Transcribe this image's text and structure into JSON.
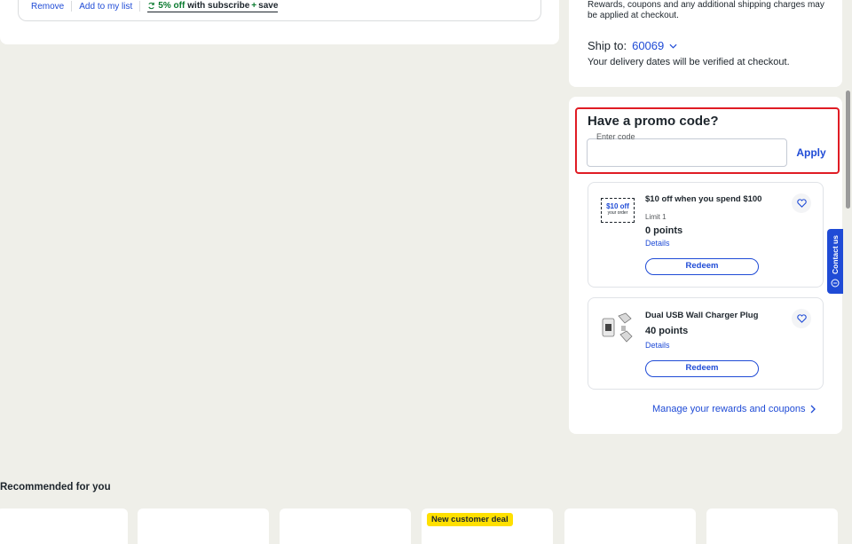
{
  "cart": {
    "remove_label": "Remove",
    "add_list_label": "Add to my list",
    "subscribe_pct": "5% off",
    "subscribe_with": "with subscribe",
    "subscribe_plus": "+",
    "subscribe_save": "save"
  },
  "summary": {
    "note": "Rewards, coupons and any additional shipping charges may be applied at checkout.",
    "ship_label": "Ship to:",
    "zip": "60069",
    "delivery_note": "Your delivery dates will be verified at checkout."
  },
  "promo": {
    "title": "Have a promo code?",
    "input_label": "Enter code",
    "input_value": "",
    "apply_label": "Apply",
    "highlight_color": "#e01c24"
  },
  "rewards": [
    {
      "title": "$10 off when you spend $100",
      "limit": "Limit 1",
      "points": "0 points",
      "details": "Details",
      "redeem": "Redeem",
      "image_top": "$10 off",
      "image_sub": "your order"
    },
    {
      "title": "Dual USB Wall Charger Plug",
      "points": "40 points",
      "details": "Details",
      "redeem": "Redeem"
    }
  ],
  "manage_link": "Manage your rewards and coupons",
  "contact": {
    "label": "Contact us"
  },
  "recommended": {
    "heading": "Recommended for you",
    "badge": "New customer deal"
  },
  "colors": {
    "accent": "#1f4bd6",
    "background": "#efefe9",
    "badge": "#ffe000"
  }
}
